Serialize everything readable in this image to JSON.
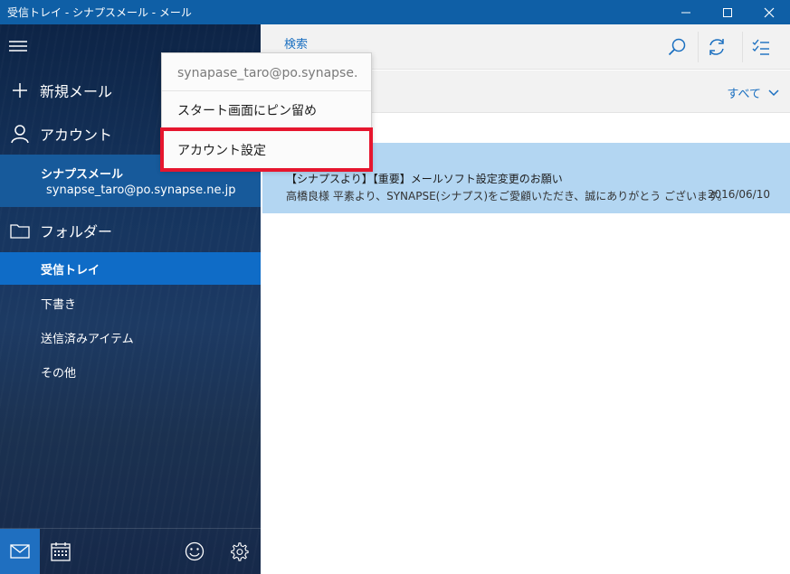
{
  "window": {
    "title": "受信トレイ - シナプスメール - メール",
    "controls": [
      "minimize",
      "maximize",
      "close"
    ]
  },
  "sidebar": {
    "menu_icon": "hamburger-icon",
    "new_mail_label": "新規メール",
    "accounts_label": "アカウント",
    "account": {
      "name": "シナプスメール",
      "email": "synapse_taro@po.synapse.ne.jp"
    },
    "folders_label": "フォルダー",
    "folders": [
      {
        "label": "受信トレイ",
        "active": true
      },
      {
        "label": "下書き",
        "active": false
      },
      {
        "label": "送信済みアイテム",
        "active": false
      },
      {
        "label": "その他",
        "active": false
      }
    ],
    "bottom_icons": [
      "mail-icon",
      "calendar-icon",
      "smiley-icon",
      "gear-icon"
    ]
  },
  "toolbar": {
    "search_placeholder": "検索",
    "icons": [
      "search-icon",
      "sync-icon",
      "select-mode-icon"
    ]
  },
  "filter": {
    "label": "すべて"
  },
  "messages": [
    {
      "subject": "【シナプスより】【重要】メールソフト設定変更のお願い",
      "preview": "高橋良様 平素より、SYNAPSE(シナプス)をご愛顧いただき、誠にありがとう ございます。",
      "date": "2016/06/10",
      "selected": true
    }
  ],
  "context_menu": {
    "email": "synapase_taro@po.synapse.",
    "items": [
      "スタート画面にピン留め",
      "アカウント設定"
    ],
    "highlighted": "アカウント設定"
  },
  "colors": {
    "titlebar": "#0f5fa6",
    "accent": "#0f6cc7",
    "selected_message": "#b3d6f2",
    "highlight_border": "#e6162e"
  }
}
